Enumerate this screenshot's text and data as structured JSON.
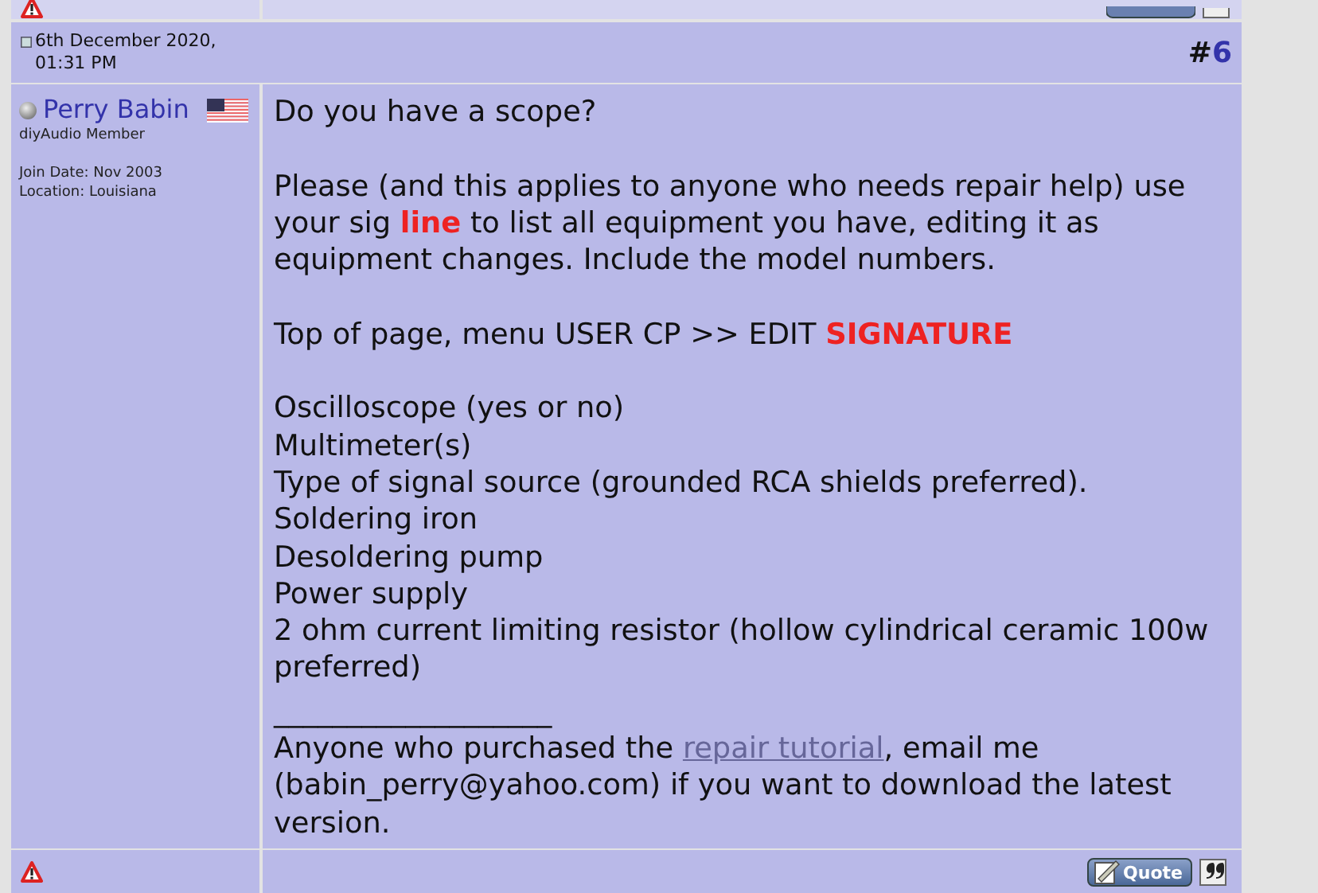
{
  "post": {
    "date": "6th December 2020, 01:31 PM",
    "hash": "#",
    "number": "6",
    "author": {
      "name": "Perry Babin",
      "online": false,
      "title": "diyAudio Member",
      "join_date": "Join Date: Nov 2003",
      "location": "Location: Louisiana"
    },
    "message": [
      {
        "kind": "paragraph",
        "text": "Do you have a scope?"
      },
      {
        "kind": "paragraph",
        "text": "Please (and this applies to anyone who needs repair help) use your sig **line** to list all equipment you have, editing it as equipment changes. Include the model numbers."
      },
      {
        "kind": "paragraph",
        "text": "Top of page, menu USER CP >> EDIT **SIGNATURE**"
      },
      {
        "kind": "list",
        "items": [
          "Oscilloscope (yes or no)",
          "Multimeter(s)",
          "Type of signal source (grounded RCA shields preferred).",
          "Soldering iron",
          "Desoldering pump",
          "Power supply",
          "2 ohm current limiting resistor (hollow cylindrical ceramic 100w preferred)"
        ]
      }
    ],
    "signature": {
      "rule": "___________________",
      "before": "Anyone who purchased the ",
      "link": "repair tutorial",
      "after": ", email me (babin_perry@yahoo.com) if you want to download the latest version."
    },
    "quote_button": "Quote"
  }
}
